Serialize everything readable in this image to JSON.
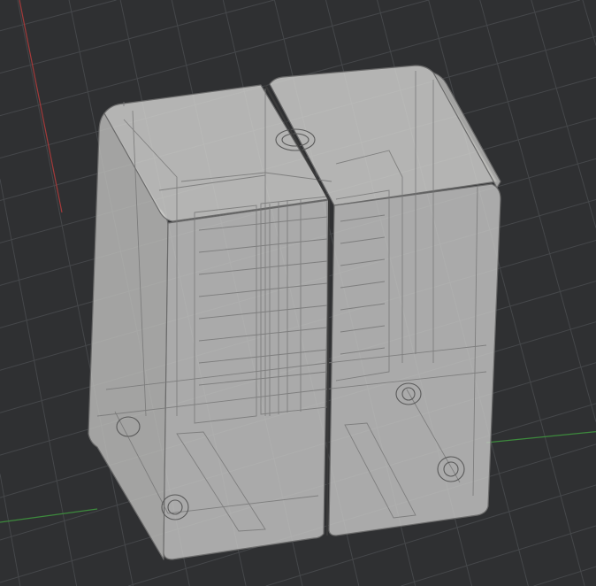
{
  "viewport": {
    "background_color": "#2f3032",
    "grid_color": "#45474a",
    "x_axis_color": "#a33a3a",
    "y_axis_color": "#3d8a3d",
    "model_fill_color": "#c9c9c7",
    "model_edge_color": "#6f6f6f"
  }
}
